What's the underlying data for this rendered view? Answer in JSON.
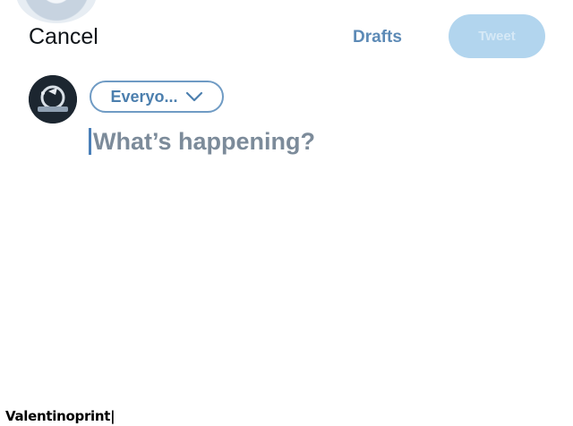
{
  "header": {
    "cancel_label": "Cancel",
    "drafts_label": "Drafts",
    "tweet_label": "Tweet",
    "tweet_enabled": false
  },
  "composer": {
    "audience_label": "Everyo...",
    "audience_icon": "chevron-down-icon",
    "placeholder": "What’s happening?"
  },
  "watermark": {
    "text": "Valentinoprint|"
  },
  "colors": {
    "accent": "#1d9bf0",
    "tweet_button_disabled": "#b2d5ee",
    "audience_border": "#6f9bc4",
    "placeholder": "#7c8b9a"
  }
}
